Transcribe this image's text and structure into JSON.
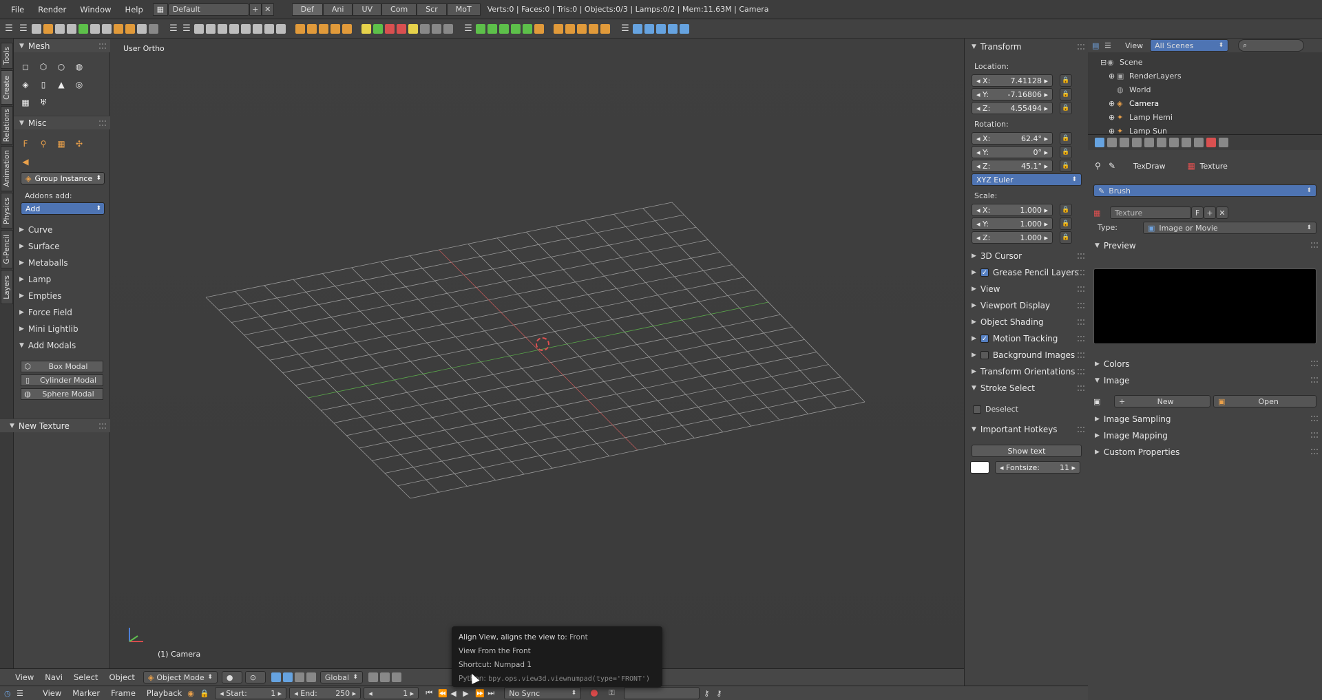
{
  "menubar": {
    "items": [
      "File",
      "Render",
      "Window",
      "Help"
    ],
    "screen_layout": "Default",
    "workspaces": [
      "Def",
      "Ani",
      "UV",
      "Com",
      "Scr",
      "MoT"
    ],
    "active_workspace": "Def",
    "stats": "Verts:0 | Faces:0 | Tris:0 | Objects:0/3 | Lamps:0/2 | Mem:11.63M | Camera"
  },
  "vtabs": [
    "Tools",
    "Create",
    "Relations",
    "Animation",
    "Physics",
    "G-Pencil",
    "Layers"
  ],
  "toolshelf": {
    "mesh_header": "Mesh",
    "misc_header": "Misc",
    "group_instance": "Group Instance",
    "addons_label": "Addons add:",
    "add_dropdown": "Add",
    "categories": [
      "Curve",
      "Surface",
      "Metaballs",
      "Lamp",
      "Empties",
      "Force Field",
      "Mini Lightlib"
    ],
    "add_modals": "Add Modals",
    "modal_buttons": [
      "Box Modal",
      "Cylinder Modal",
      "Sphere Modal"
    ],
    "new_texture": "New Texture"
  },
  "viewport": {
    "view_label": "User Ortho",
    "object_label": "(1) Camera"
  },
  "vheader": {
    "items": [
      "View",
      "Navi",
      "Select",
      "Object"
    ],
    "mode": "Object Mode",
    "orientation": "Global"
  },
  "npanel": {
    "transform": "Transform",
    "location_label": "Location:",
    "location": [
      {
        "axis": "X:",
        "value": "7.41128"
      },
      {
        "axis": "Y:",
        "value": "-7.16806"
      },
      {
        "axis": "Z:",
        "value": "4.55494"
      }
    ],
    "rotation_label": "Rotation:",
    "rotation": [
      {
        "axis": "X:",
        "value": "62.4°"
      },
      {
        "axis": "Y:",
        "value": "0°"
      },
      {
        "axis": "Z:",
        "value": "45.1°"
      }
    ],
    "rotation_mode": "XYZ Euler",
    "scale_label": "Scale:",
    "scale": [
      {
        "axis": "X:",
        "value": "1.000"
      },
      {
        "axis": "Y:",
        "value": "1.000"
      },
      {
        "axis": "Z:",
        "value": "1.000"
      }
    ],
    "panels": [
      "3D Cursor",
      "Grease Pencil Layers",
      "View",
      "Viewport Display",
      "Object Shading",
      "Motion Tracking",
      "Background Images",
      "Transform Orientations"
    ],
    "stroke_select": "Stroke Select",
    "deselect": "Deselect",
    "important_hotkeys": "Important Hotkeys",
    "show_text": "Show text",
    "fontsize_label": "Fontsize:",
    "fontsize": "11"
  },
  "outliner": {
    "view": "View",
    "scenes": "All Scenes",
    "items": [
      "Scene",
      "RenderLayers",
      "World",
      "Camera",
      "Lamp Hemi",
      "Lamp Sun"
    ]
  },
  "props": {
    "texdraw": "TexDraw",
    "texture_tab": "Texture",
    "brush": "Brush",
    "texture_name": "Texture",
    "fake_user": "F",
    "type_label": "Type:",
    "type_value": "Image or Movie",
    "preview": "Preview",
    "colors": "Colors",
    "image": "Image",
    "new": "New",
    "open": "Open",
    "image_sampling": "Image Sampling",
    "image_mapping": "Image Mapping",
    "custom_properties": "Custom Properties"
  },
  "timeline": {
    "items": [
      "View",
      "Marker",
      "Frame",
      "Playback"
    ],
    "start_label": "Start:",
    "start": "1",
    "end_label": "End:",
    "end": "250",
    "current": "1",
    "sync": "No Sync"
  },
  "tooltip": {
    "line1_a": "Align View, aligns the view to:",
    "line1_b": "Front",
    "line2": "View From the Front",
    "line3": "Shortcut: Numpad 1",
    "line4_a": "Python:",
    "line4_b": "bpy.ops.view3d.viewnumpad(type='FRONT')"
  }
}
